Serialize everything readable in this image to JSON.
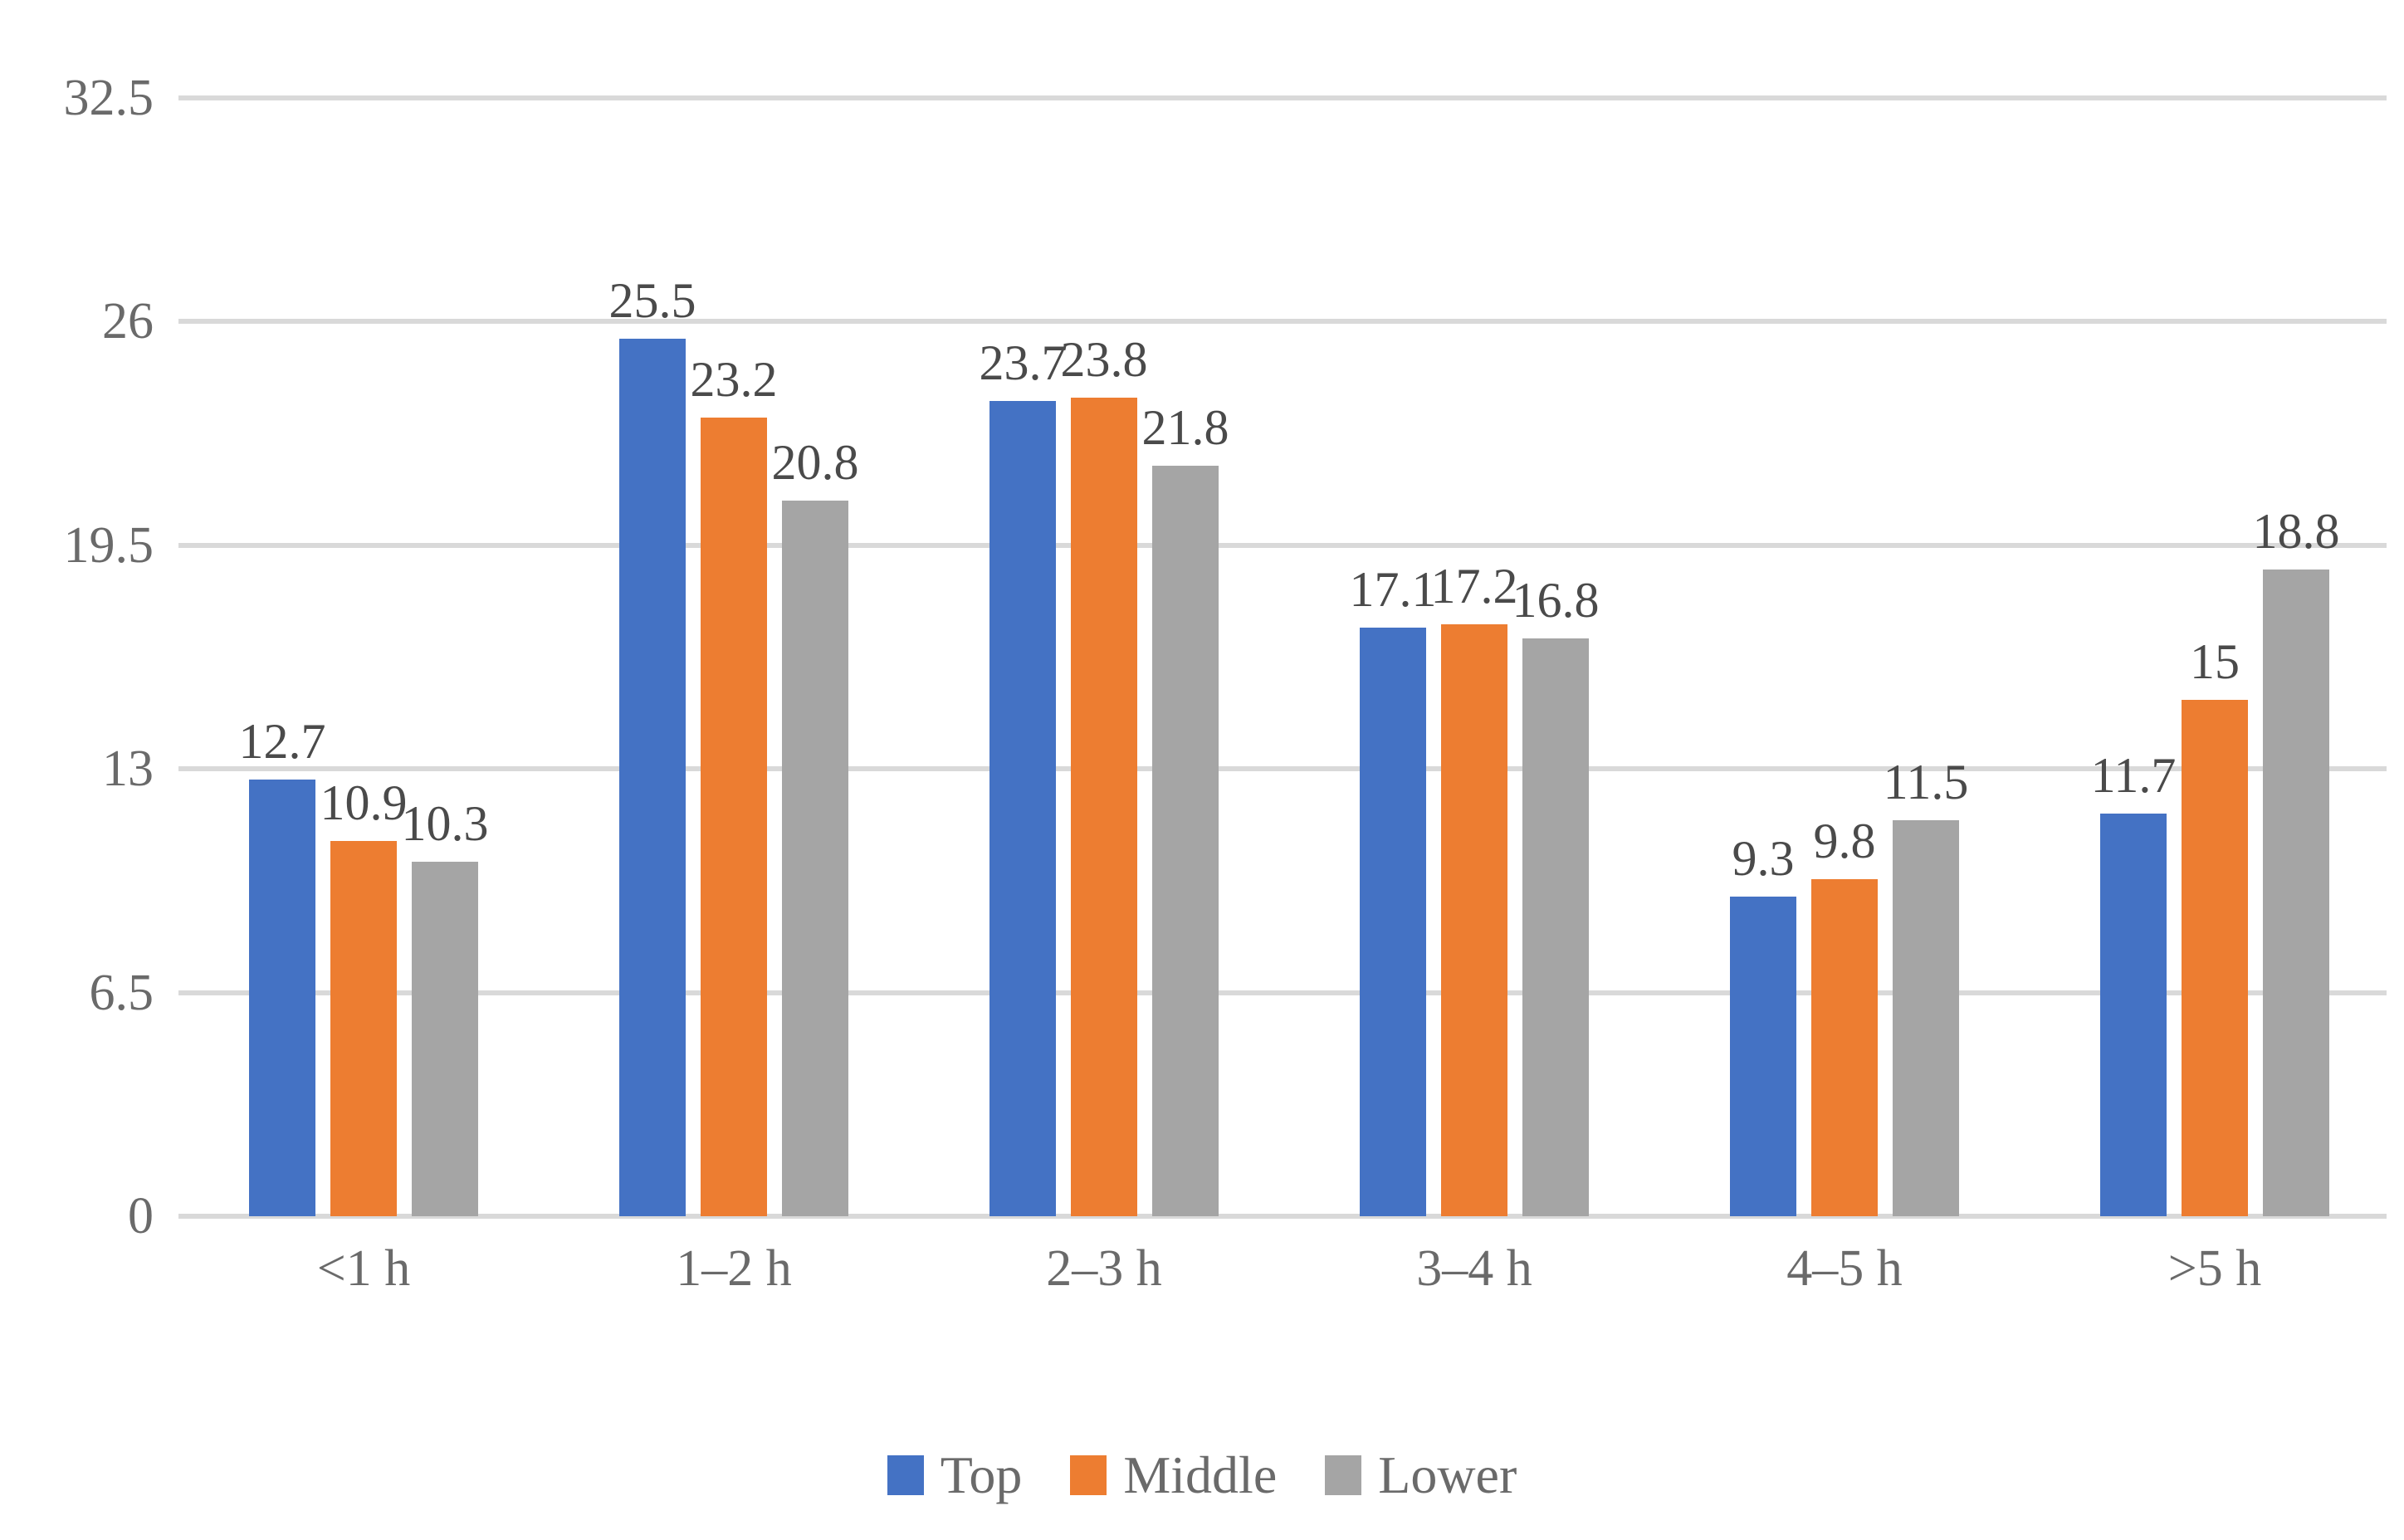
{
  "chart_data": {
    "type": "bar",
    "title": "",
    "subtitle": "",
    "xlabel": "",
    "ylabel": "",
    "categories": [
      "<1 h",
      "1–2 h",
      "2–3 h",
      "3–4 h",
      "4–5 h",
      ">5 h"
    ],
    "series": [
      {
        "name": "Top",
        "color": "#4472c4",
        "values": [
          12.7,
          25.5,
          23.7,
          17.1,
          9.3,
          11.7
        ],
        "value_labels": [
          "12.7",
          "25.5",
          "23.7",
          "17.1",
          "9.3",
          "11.7"
        ]
      },
      {
        "name": "Middle",
        "color": "#ed7d31",
        "values": [
          10.9,
          23.2,
          23.8,
          17.2,
          9.8,
          15
        ],
        "value_labels": [
          "10.9",
          "23.2",
          "23.8",
          "17.2",
          "9.8",
          "15"
        ]
      },
      {
        "name": "Lower",
        "color": "#a5a5a5",
        "values": [
          10.3,
          20.8,
          21.8,
          16.8,
          11.5,
          18.8
        ],
        "value_labels": [
          "10.3",
          "20.8",
          "21.8",
          "16.8",
          "11.5",
          "18.8"
        ]
      }
    ],
    "ylim": [
      0,
      32.5
    ],
    "yticks": [
      0,
      6.5,
      13,
      19.5,
      26,
      32.5
    ],
    "ytick_labels": [
      "0",
      "6.5",
      "13",
      "19.5",
      "26",
      "32.5"
    ],
    "grid": "horizontal",
    "legend_position": "bottom",
    "legend_entries": [
      "Top",
      "Middle",
      "Lower"
    ],
    "bar_value_labels": true
  },
  "axis": {
    "y_axis_color": "#6a6a6a",
    "x_axis_color": "#6a6a6a",
    "gridline_color": "#d9d9d9"
  }
}
